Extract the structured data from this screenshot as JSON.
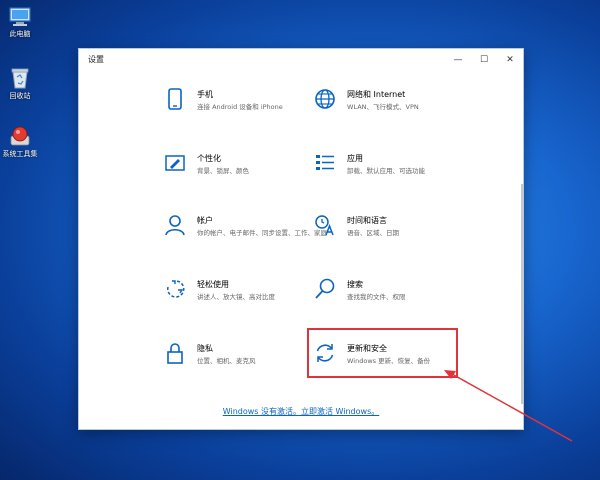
{
  "desktop": {
    "icons": [
      {
        "name": "此电脑",
        "icon": "computer-icon"
      },
      {
        "name": "回收站",
        "icon": "recycle-bin-icon"
      },
      {
        "name": "系统工具集",
        "icon": "tool-app-icon"
      }
    ]
  },
  "window": {
    "title": "设置",
    "controls": {
      "minimize": "—",
      "maximize": "☐",
      "close": "✕"
    }
  },
  "tiles": [
    {
      "name": "手机",
      "desc": "连接 Android 设备和 iPhone",
      "icon": "phone-icon"
    },
    {
      "name": "网络和 Internet",
      "desc": "WLAN、飞行模式、VPN",
      "icon": "globe-icon"
    },
    {
      "name": "个性化",
      "desc": "背景、锁屏、颜色",
      "icon": "personalization-icon"
    },
    {
      "name": "应用",
      "desc": "卸载、默认应用、可选功能",
      "icon": "apps-icon"
    },
    {
      "name": "帐户",
      "desc": "你的帐户、电子邮件、同步设置、工作、家庭",
      "icon": "account-icon"
    },
    {
      "name": "时间和语言",
      "desc": "语音、区域、日期",
      "icon": "time-language-icon"
    },
    {
      "name": "轻松使用",
      "desc": "讲述人、放大镜、高对比度",
      "icon": "ease-of-access-icon"
    },
    {
      "name": "搜索",
      "desc": "查找我的文件、权限",
      "icon": "search-icon"
    },
    {
      "name": "隐私",
      "desc": "位置、相机、麦克风",
      "icon": "lock-icon"
    },
    {
      "name": "更新和安全",
      "desc": "Windows 更新、恢复、备份",
      "icon": "update-icon"
    }
  ],
  "activation_link": "Windows 没有激活。立即激活 Windows。",
  "colors": {
    "accent": "#0a64c2",
    "annotation": "#e0333a"
  }
}
